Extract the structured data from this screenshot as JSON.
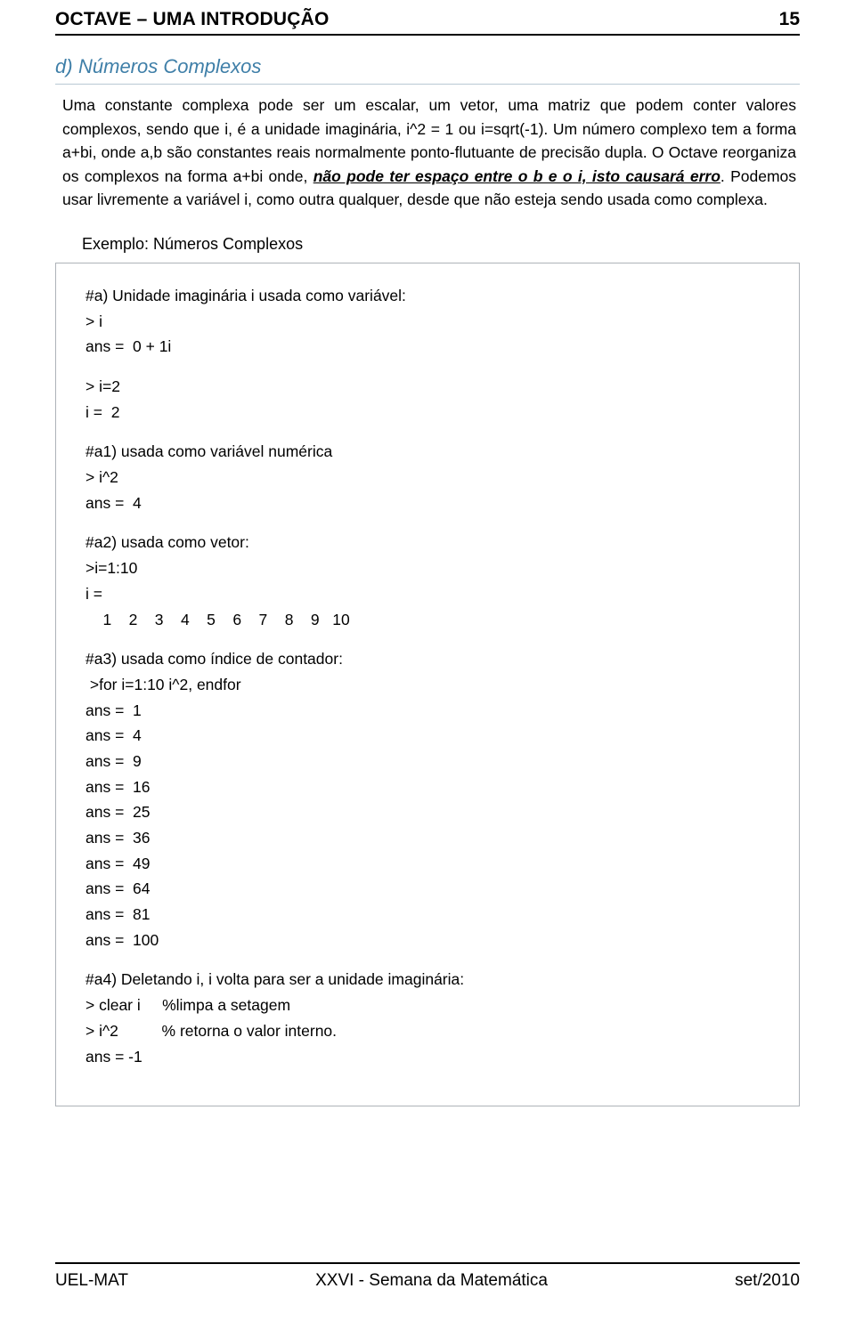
{
  "header": {
    "title": "OCTAVE – UMA INTRODUÇÃO",
    "page_number": "15"
  },
  "section": {
    "letter": "d)",
    "title": "Números Complexos",
    "accent_color": "#3f7fa8"
  },
  "paragraph": {
    "part1": "Uma constante complexa pode ser um escalar, um vetor, uma matriz que podem conter valores complexos, sendo que i, é  a unidade imaginária, i^2 = 1 ou i=sqrt(-1). Um número complexo tem a forma a+bi, onde a,b são constantes reais normalmente ponto-flutuante de precisão dupla. O Octave reorganiza os complexos na forma a+bi onde, ",
    "emphasis": "não pode ter espaço entre o b e o i, isto causará erro",
    "part2": ". Podemos usar livremente a variável i, como outra qualquer, desde que não esteja sendo usada como complexa."
  },
  "example_label": "Exemplo:  Números Complexos",
  "code_lines": [
    "#a) Unidade imaginária i usada como variável:",
    "> i",
    "ans =  0 + 1i",
    "",
    "> i=2",
    "i =  2",
    "",
    "#a1) usada como variável numérica",
    "> i^2",
    "ans =  4",
    "",
    "#a2) usada como vetor:",
    ">i=1:10",
    "i =",
    "    1    2    3    4    5    6    7    8    9   10",
    "",
    "#a3) usada como índice de contador:",
    " >for i=1:10 i^2, endfor",
    "ans =  1",
    "ans =  4",
    "ans =  9",
    "ans =  16",
    "ans =  25",
    "ans =  36",
    "ans =  49",
    "ans =  64",
    "ans =  81",
    "ans =  100",
    "",
    "#a4) Deletando i, i volta para ser a unidade imaginária:",
    "> clear i     %limpa a setagem",
    "> i^2          % retorna o valor interno.",
    "ans = -1"
  ],
  "footer": {
    "left": "UEL-MAT",
    "center": "XXVI - Semana da Matemática",
    "right": "set/2010"
  }
}
